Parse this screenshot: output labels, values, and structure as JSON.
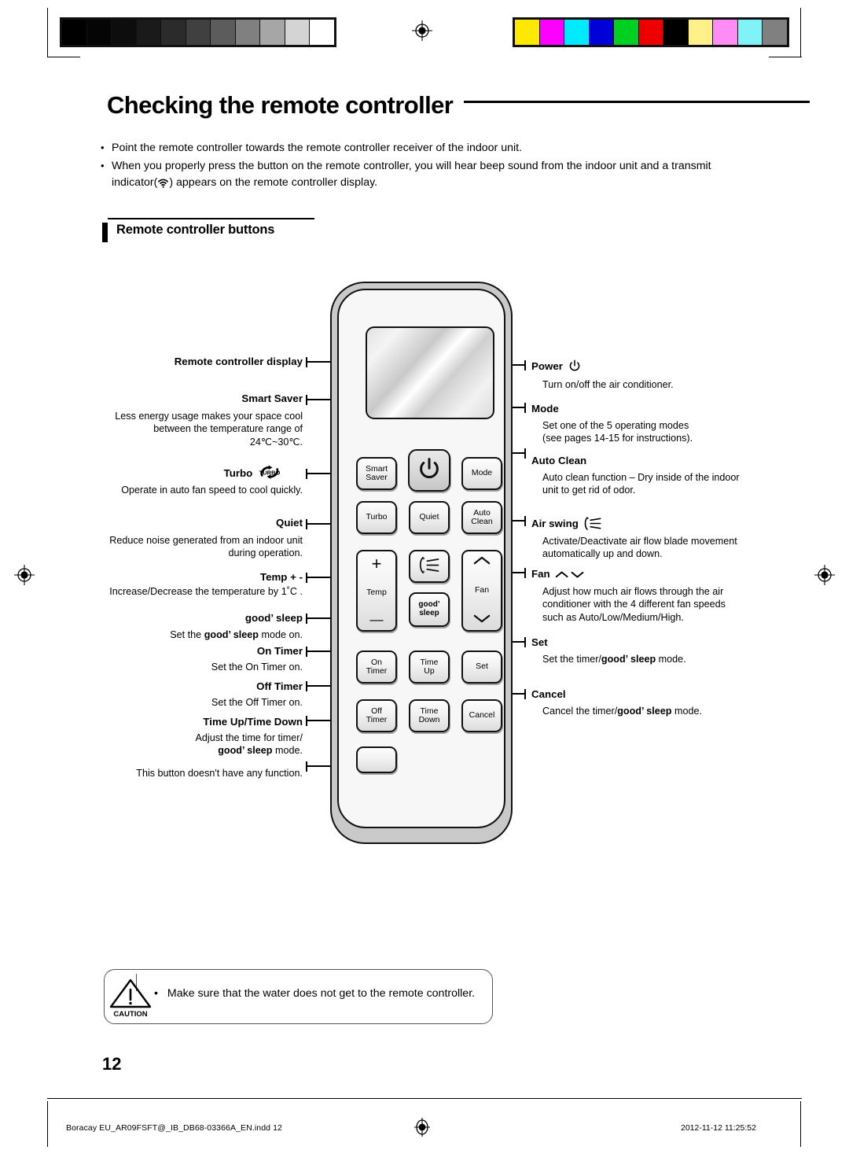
{
  "page": {
    "title": "Checking the remote controller",
    "number": "12",
    "section_heading": "Remote controller buttons"
  },
  "intro": {
    "bullet_symbol": "•",
    "items": [
      {
        "text": "Point the remote controller towards the remote controller receiver of the indoor unit."
      },
      {
        "text_before": "When you properly press the button on the remote controller, you will hear beep sound from the indoor unit and a transmit indicator(",
        "icon": "transmit-wifi-icon",
        "text_after": ") appears on the remote controller display."
      }
    ]
  },
  "remote": {
    "display_label": "remote-display-screen",
    "buttons": [
      {
        "id": "smart-saver",
        "label": "Smart\nSaver",
        "line1": "Smart",
        "line2": "Saver"
      },
      {
        "id": "power",
        "label": "Power",
        "icon": "power-icon"
      },
      {
        "id": "mode",
        "label": "Mode"
      },
      {
        "id": "turbo",
        "label": "Turbo"
      },
      {
        "id": "quiet",
        "label": "Quiet"
      },
      {
        "id": "auto-clean",
        "label": "Auto\nClean",
        "line1": "Auto",
        "line2": "Clean"
      },
      {
        "id": "temp",
        "label": "Temp",
        "plus": "+",
        "minus": "—"
      },
      {
        "id": "air-swing",
        "label": "",
        "icon": "air-swing-icon"
      },
      {
        "id": "fan",
        "label": "Fan",
        "icon": "fan-up-down-icon"
      },
      {
        "id": "good-sleep",
        "line1": "good’",
        "line2": "sleep"
      },
      {
        "id": "on-timer",
        "line1": "On",
        "line2": "Timer"
      },
      {
        "id": "time-up",
        "line1": "Time",
        "line2": "Up"
      },
      {
        "id": "set",
        "label": "Set"
      },
      {
        "id": "off-timer",
        "line1": "Off",
        "line2": "Timer"
      },
      {
        "id": "time-down",
        "line1": "Time",
        "line2": "Down"
      },
      {
        "id": "cancel",
        "label": "Cancel"
      },
      {
        "id": "blank",
        "label": ""
      }
    ]
  },
  "annotations_left": [
    {
      "id": "remote-controller-display",
      "label": "Remote controller display",
      "desc": ""
    },
    {
      "id": "smart-saver",
      "label": "Smart Saver",
      "desc": "Less energy usage makes your space cool between the temperature range of 24℃~30℃."
    },
    {
      "id": "turbo",
      "label": "Turbo",
      "icon": "turbo-icon",
      "desc": "Operate in auto fan speed to cool quickly."
    },
    {
      "id": "quiet",
      "label": "Quiet",
      "desc": "Reduce noise generated from an indoor unit during operation."
    },
    {
      "id": "temp",
      "label": "Temp + -",
      "desc": "Increase/Decrease the temperature by 1˚C ."
    },
    {
      "id": "good-sleep",
      "label": "good’ sleep",
      "desc_before": "Set the ",
      "desc_bold": "good’ sleep",
      "desc_after": " mode on."
    },
    {
      "id": "on-timer",
      "label": "On Timer",
      "desc": "Set the On Timer on."
    },
    {
      "id": "off-timer",
      "label": "Off Timer",
      "desc": "Set the Off Timer on."
    },
    {
      "id": "time-up-down",
      "label": "Time Up/Time Down",
      "desc_before": "Adjust the time for timer/",
      "desc_bold": "good’ sleep",
      "desc_after": " mode."
    },
    {
      "id": "no-function",
      "label": "",
      "desc": "This button doesn't have any function."
    }
  ],
  "annotations_right": [
    {
      "id": "power",
      "label": "Power",
      "icon": "power-icon",
      "desc": "Turn on/off the air conditioner."
    },
    {
      "id": "mode",
      "label": "Mode",
      "desc_l1": "Set one of the 5 operating modes",
      "desc_l2": "(see pages 14-15 for instructions)."
    },
    {
      "id": "auto-clean",
      "label": "Auto Clean",
      "desc_l1": "Auto clean function – Dry inside of the indoor",
      "desc_l2": "unit to get rid of odor."
    },
    {
      "id": "air-swing",
      "label": "Air swing",
      "icon": "air-swing-icon",
      "desc_l1": "Activate/Deactivate air flow blade movement",
      "desc_l2": "automatically up and down."
    },
    {
      "id": "fan",
      "label": "Fan",
      "icon": "fan-up-down-icon",
      "desc_l1": "Adjust how much air flows through the air",
      "desc_l2": "conditioner with the 4 different fan speeds",
      "desc_l3": "such as Auto/Low/Medium/High."
    },
    {
      "id": "set",
      "label": "Set",
      "desc_before": "Set the timer/",
      "desc_bold": "good’ sleep",
      "desc_after": " mode."
    },
    {
      "id": "cancel",
      "label": "Cancel",
      "desc_before": "Cancel the timer/",
      "desc_bold": "good’ sleep",
      "desc_after": " mode."
    }
  ],
  "caution": {
    "icon": "caution-triangle-icon",
    "icon_label": "CAUTION",
    "bullet": "•",
    "text": "Make sure that the water does not get to the remote controller."
  },
  "footer": {
    "left": "Boracay EU_AR09FSFT@_IB_DB68-03366A_EN.indd   12",
    "right": "2012-11-12   11:25:52",
    "reg_mark": "registration-target-icon"
  },
  "calibration": {
    "grayscale": [
      "#000000",
      "#050505",
      "#0d0d0d",
      "#1a1a1a",
      "#2b2b2b",
      "#404040",
      "#5c5c5c",
      "#808080",
      "#a6a6a6",
      "#d4d4d4",
      "#ffffff"
    ],
    "colors": [
      "#ffe800",
      "#ff00ff",
      "#00eaff",
      "#0000d8",
      "#00d120",
      "#ee0000",
      "#000000",
      "#fff089",
      "#ff8cf5",
      "#7ff3f7",
      "#808080"
    ]
  }
}
